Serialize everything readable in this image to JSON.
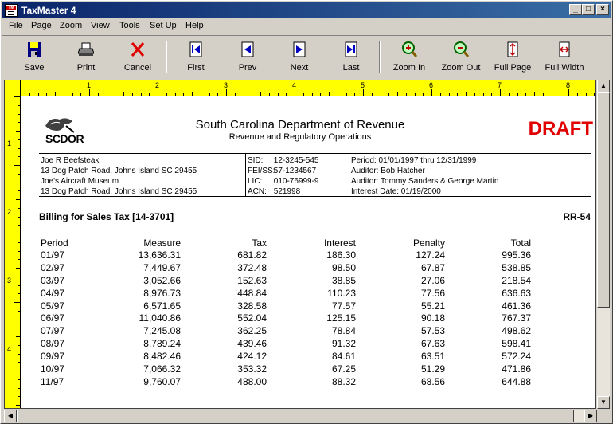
{
  "window": {
    "title": "TaxMaster 4",
    "app_icon_text": "TM"
  },
  "title_buttons": [
    "_",
    "□",
    "×"
  ],
  "menu": [
    {
      "label": "File",
      "key": "F",
      "rest": "ile"
    },
    {
      "label": "Page",
      "key": "P",
      "rest": "age"
    },
    {
      "label": "Zoom",
      "key": "Z",
      "rest": "oom"
    },
    {
      "label": "View",
      "key": "V",
      "rest": "iew"
    },
    {
      "label": "Tools",
      "key": "T",
      "rest": "ools"
    },
    {
      "label": "Set Up",
      "key": "",
      "pre": "Set ",
      "key2": "U",
      "rest2": "p"
    },
    {
      "label": "Help",
      "key": "H",
      "rest": "elp"
    }
  ],
  "toolbar": {
    "save": "Save",
    "print": "Print",
    "cancel": "Cancel",
    "first": "First",
    "prev": "Prev",
    "next": "Next",
    "last": "Last",
    "zoom_in": "Zoom In",
    "zoom_out": "Zoom Out",
    "full_page": "Full Page",
    "full_width": "Full Width"
  },
  "ruler": {
    "top": [
      "1",
      "2",
      "3",
      "4",
      "5",
      "6",
      "7",
      "8"
    ],
    "left": [
      "1",
      "2",
      "3",
      "4"
    ]
  },
  "report": {
    "logo_text": "SCDOR",
    "title": "South Carolina Department of Revenue",
    "subtitle": "Revenue and Regulatory Operations",
    "stamp": "DRAFT",
    "taxpayer": [
      "Joe R Beefsteak",
      "13 Dog Patch Road, Johns Island SC  29455",
      "Joe's Aircraft Museum",
      "13 Dog Patch Road, Johns Island SC  29455"
    ],
    "ids": [
      {
        "k": "SID:",
        "v": "12-3245-545"
      },
      {
        "k": "FEI/SS:",
        "v": "57-1234567"
      },
      {
        "k": "LIC:",
        "v": "010-76999-9"
      },
      {
        "k": "ACN:",
        "v": "521998"
      }
    ],
    "audit": [
      "Period: 01/01/1997 thru 12/31/1999",
      "Auditor: Bob Hatcher",
      "Auditor: Tommy Sanders & George Martin",
      "Interest Date: 01/19/2000"
    ],
    "billing_title": "Billing for Sales Tax [14-3701]",
    "billing_code": "RR-54",
    "columns": [
      "Period",
      "Measure",
      "Tax",
      "Interest",
      "Penalty",
      "Total"
    ],
    "rows": [
      [
        "01/97",
        "13,636.31",
        "681.82",
        "186.30",
        "127.24",
        "995.36"
      ],
      [
        "02/97",
        "7,449.67",
        "372.48",
        "98.50",
        "67.87",
        "538.85"
      ],
      [
        "03/97",
        "3,052.66",
        "152.63",
        "38.85",
        "27.06",
        "218.54"
      ],
      [
        "04/97",
        "8,976.73",
        "448.84",
        "110.23",
        "77.56",
        "636.63"
      ],
      [
        "05/97",
        "6,571.65",
        "328.58",
        "77.57",
        "55.21",
        "461.36"
      ],
      [
        "06/97",
        "11,040.86",
        "552.04",
        "125.15",
        "90.18",
        "767.37"
      ],
      [
        "07/97",
        "7,245.08",
        "362.25",
        "78.84",
        "57.53",
        "498.62"
      ],
      [
        "08/97",
        "8,789.24",
        "439.46",
        "91.32",
        "67.63",
        "598.41"
      ],
      [
        "09/97",
        "8,482.46",
        "424.12",
        "84.61",
        "63.51",
        "572.24"
      ],
      [
        "10/97",
        "7,066.32",
        "353.32",
        "67.25",
        "51.29",
        "471.86"
      ],
      [
        "11/97",
        "9,760.07",
        "488.00",
        "88.32",
        "68.56",
        "644.88"
      ]
    ]
  }
}
